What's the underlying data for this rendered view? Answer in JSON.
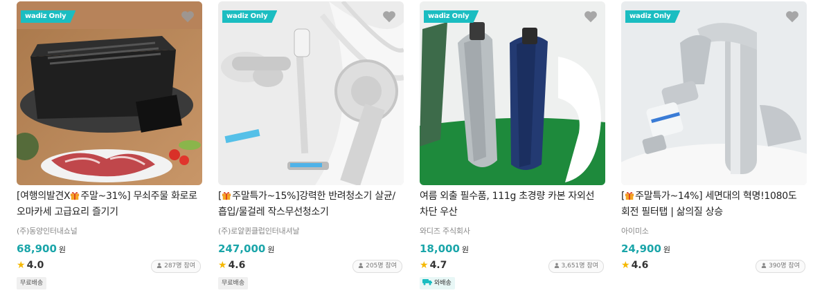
{
  "colors": {
    "accent": "#1bbdc1",
    "price": "#1aa5a9",
    "star": "#f5b800"
  },
  "products": [
    {
      "badge": "wadiz Only",
      "title_before": "[여행의발견X",
      "title_after": "주말~31%] 무쇠주물 화로로 오마카세 고급요리 즐기기",
      "maker": "(주)동양인터내쇼널",
      "price": "68,900",
      "currency": "원",
      "rating": "4.0",
      "participants": "287명 참여",
      "tag": "무료배송",
      "thumb_icon": "cast-iron-grill-image"
    },
    {
      "badge": "wadiz Only",
      "title_before": "[",
      "title_after": "주말특가~15%]강력한 반려청소기 살균/흡입/물걸레 작스무선청소기",
      "maker": "(주)로얄퀸클럽인터내셔날",
      "price": "247,000",
      "currency": "원",
      "rating": "4.6",
      "participants": "205명 참여",
      "tag": "무료배송",
      "thumb_icon": "cordless-vacuum-image"
    },
    {
      "badge": "wadiz Only",
      "title_before": "",
      "title_after": "여름 외출 필수품, 111g 초경량 카본 자외선차단 우산",
      "maker": "와디즈 주식회사",
      "price": "18,000",
      "currency": "원",
      "rating": "4.7",
      "participants": "3,651명 참여",
      "tag": "와배송",
      "thumb_icon": "umbrella-image"
    },
    {
      "badge": "wadiz Only",
      "title_before": "[",
      "title_after": "주말특가~14%] 세면대의 혁명!1080도 회전 필터탭 | 삶의질 상승",
      "maker": "아이미소",
      "price": "24,900",
      "currency": "원",
      "rating": "4.6",
      "participants": "390명 참여",
      "tag": "",
      "thumb_icon": "faucet-filter-image"
    }
  ]
}
